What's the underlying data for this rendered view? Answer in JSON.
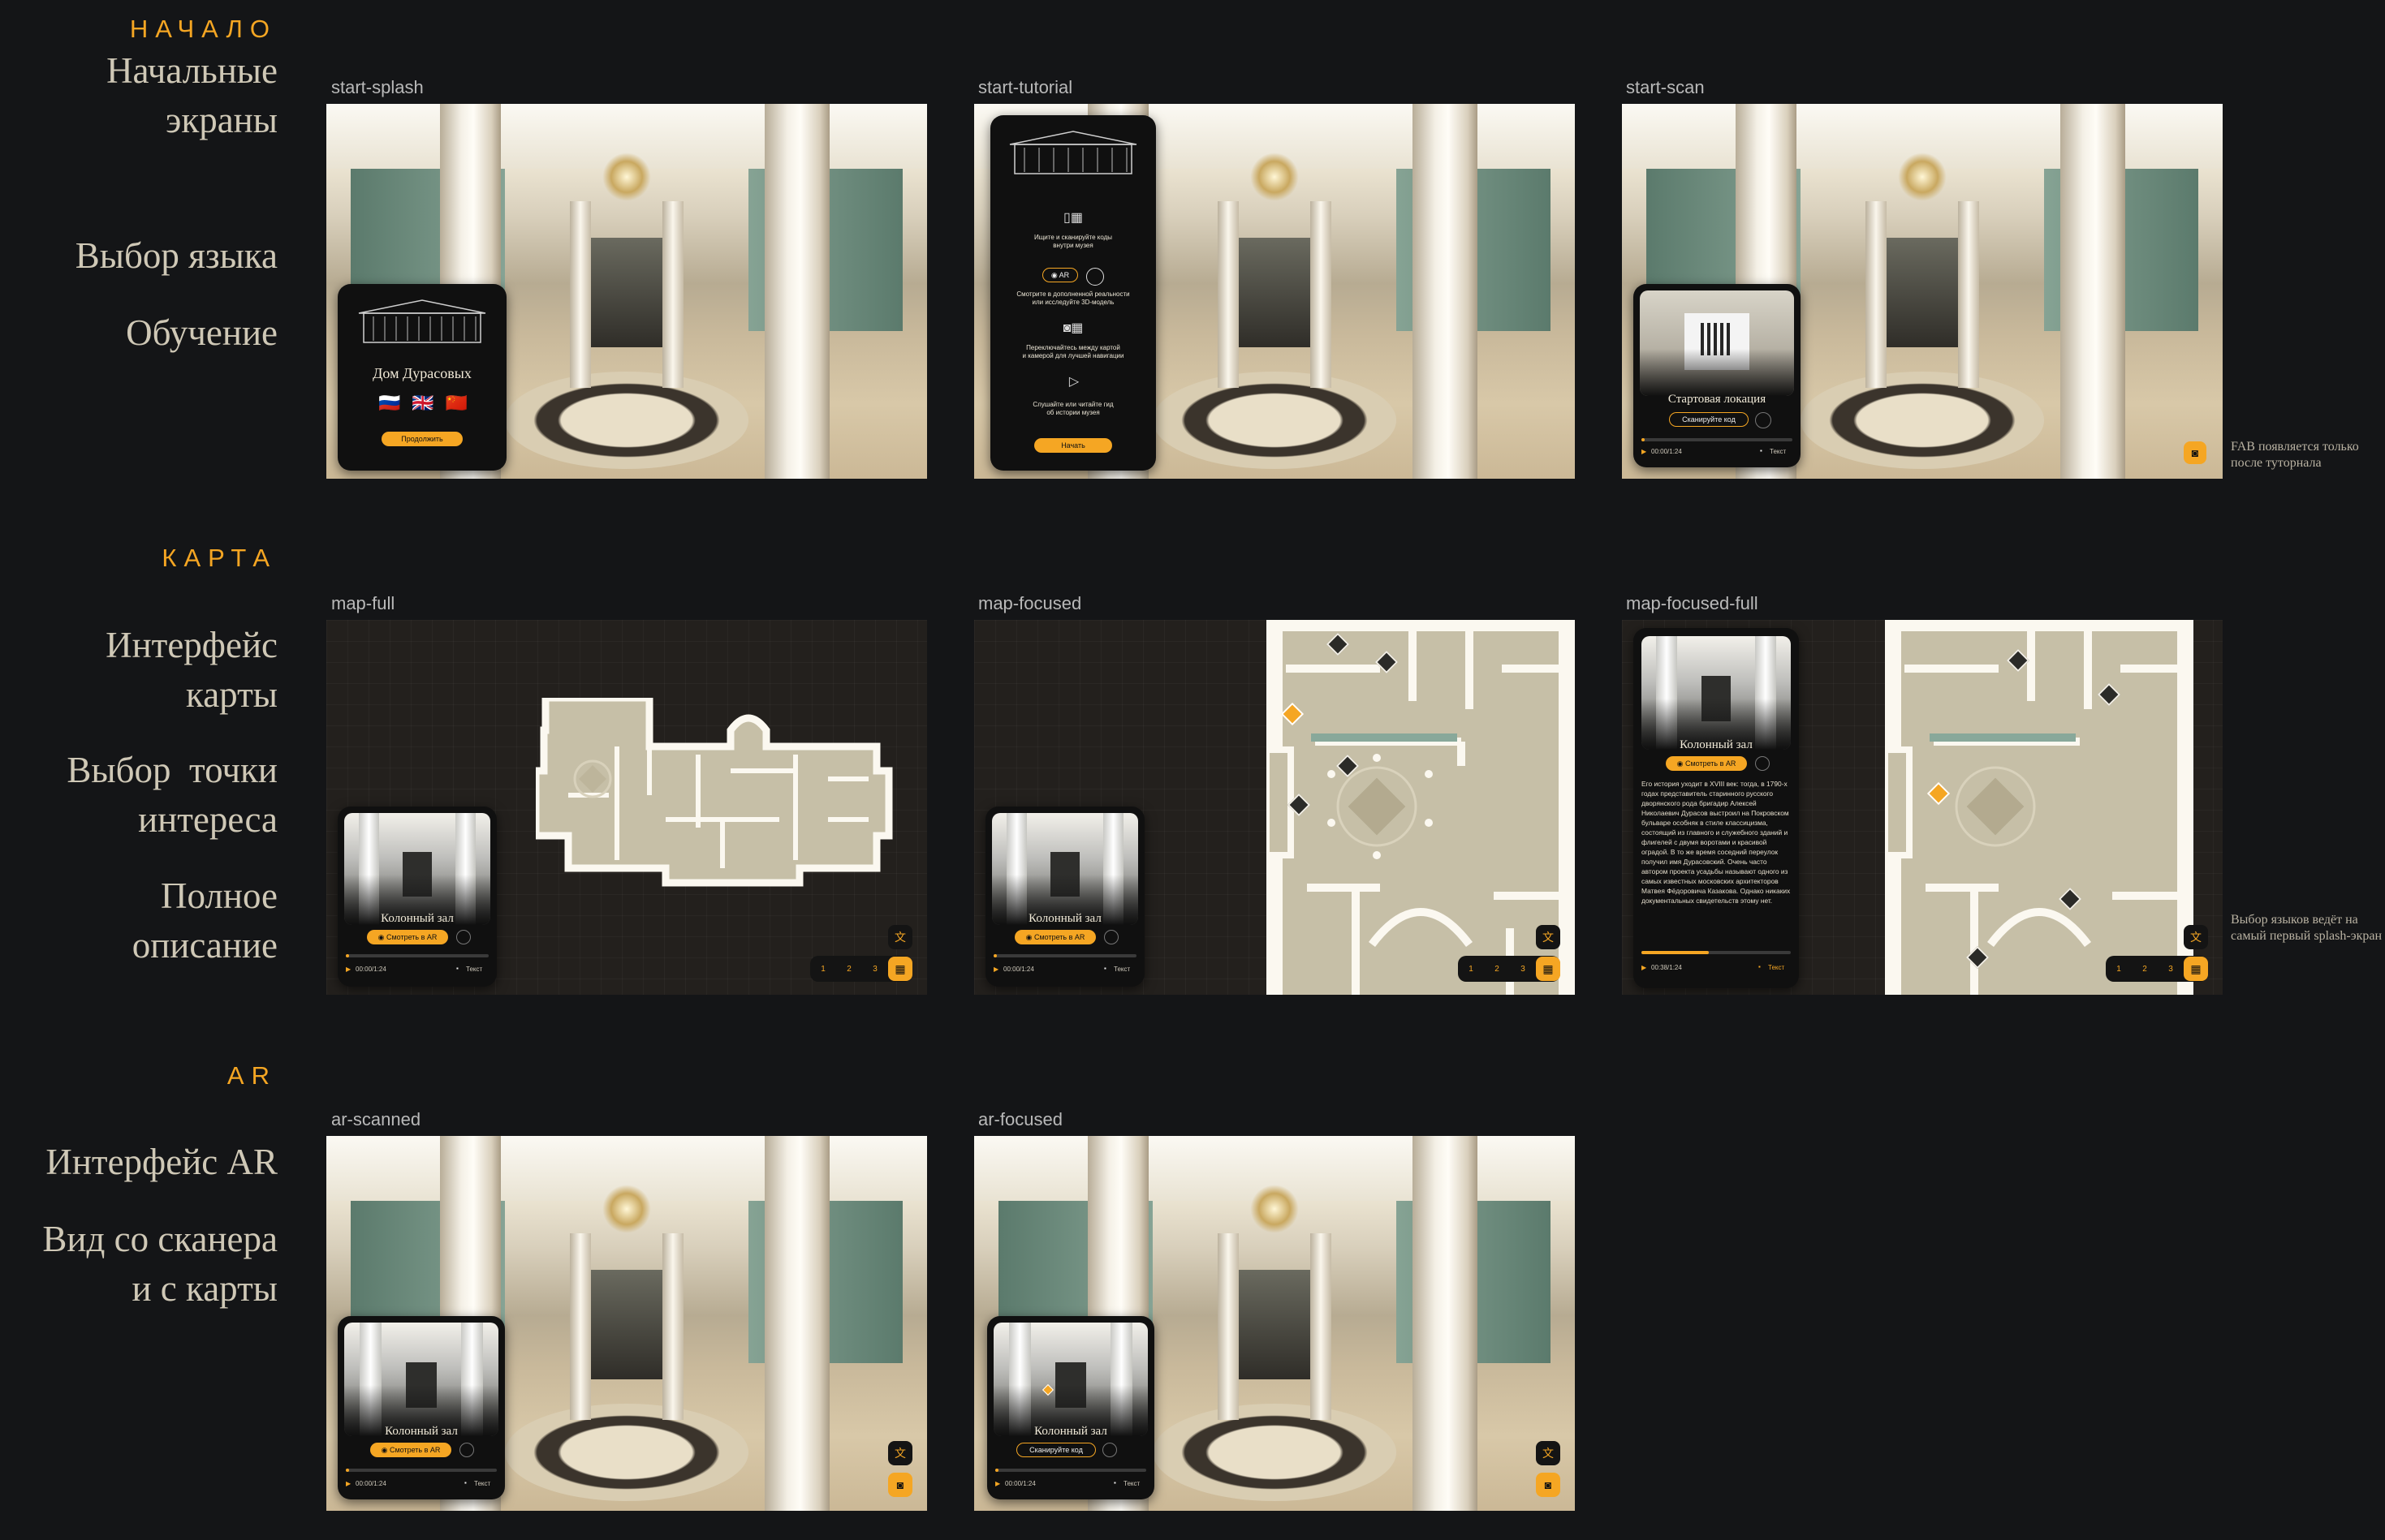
{
  "sections": {
    "start": {
      "title": "НАЧАЛО",
      "labels": [
        "Начальные\nэкраны",
        "Выбор языка",
        "Обучение"
      ]
    },
    "map": {
      "title": "КАРТА",
      "labels": [
        "Интерфейс\nкарты",
        "Выбор  точки\nинтереса",
        "Полное\nописание"
      ]
    },
    "ar": {
      "title": "AR",
      "labels": [
        "Интерфейс AR",
        "Вид со сканера\nи с карты"
      ]
    }
  },
  "frames": {
    "start_splash": "start-splash",
    "start_tutorial": "start-tutorial",
    "start_scan": "start-scan",
    "map_full": "map-full",
    "map_focused": "map-focused",
    "map_focused_full": "map-focused-full",
    "ar_scanned": "ar-scanned",
    "ar_focused": "ar-focused"
  },
  "notes": {
    "fab": "FAB появляется только после туторнала",
    "lang": "Выбор языков ведёт на самый первый splash-экран"
  },
  "splash": {
    "title": "Дом Дурасовых",
    "continue": "Продолжить",
    "flags": [
      "🇷🇺",
      "🇬🇧",
      "🇨🇳"
    ]
  },
  "tutorial": {
    "step1": "Ищите и сканируйте коды\nвнутри музея",
    "ar_pill": "AR",
    "step2": "Смотрите в дополненной реальности\nили исследуйте 3D-модель",
    "step3": "Переключайтесь между картой\nи камерой для лучшей навигации",
    "step4": "Слушайте или читайте гид\nоб истории музея",
    "start": "Начать"
  },
  "scan": {
    "title": "Стартовая локация",
    "scan_btn": "Сканируйте код",
    "time": "00:00/1:24",
    "text_toggle": "Текст"
  },
  "poi": {
    "title": "Колонный зал",
    "ar_btn": "Смотреть в AR",
    "scan_btn": "Сканируйте код",
    "time": "00:00/1:24",
    "time_long": "00:38/1:24",
    "text_toggle": "Текст",
    "description": "Его история уходит в XVIII век: тогда, в 1790-х годах представитель старинного русского дворянского рода бригадир Алексей Николаевич Дурасов выстроил на Покровском бульваре особняк в стиле классицизма, состоящий из главного и служебного зданий и флигелей с двумя воротами и красивой оградой. В то же время соседний переулок получил имя Дурасовский. Очень часто автором проекта усадьбы называют одного из самых известных московских архитекторов Матвея Фёдоровича Казакова. Однако никаких документальных свидетельств этому нет."
  },
  "pager": [
    "1",
    "2",
    "3"
  ],
  "icons": {
    "translate": "translate-icon",
    "map": "map-icon",
    "qr": "qr-icon",
    "eye": "eye-icon",
    "play": "play-icon",
    "text": "text-icon"
  },
  "colors": {
    "accent": "#f5a623",
    "background": "#141517",
    "label": "#cfc8b6"
  }
}
